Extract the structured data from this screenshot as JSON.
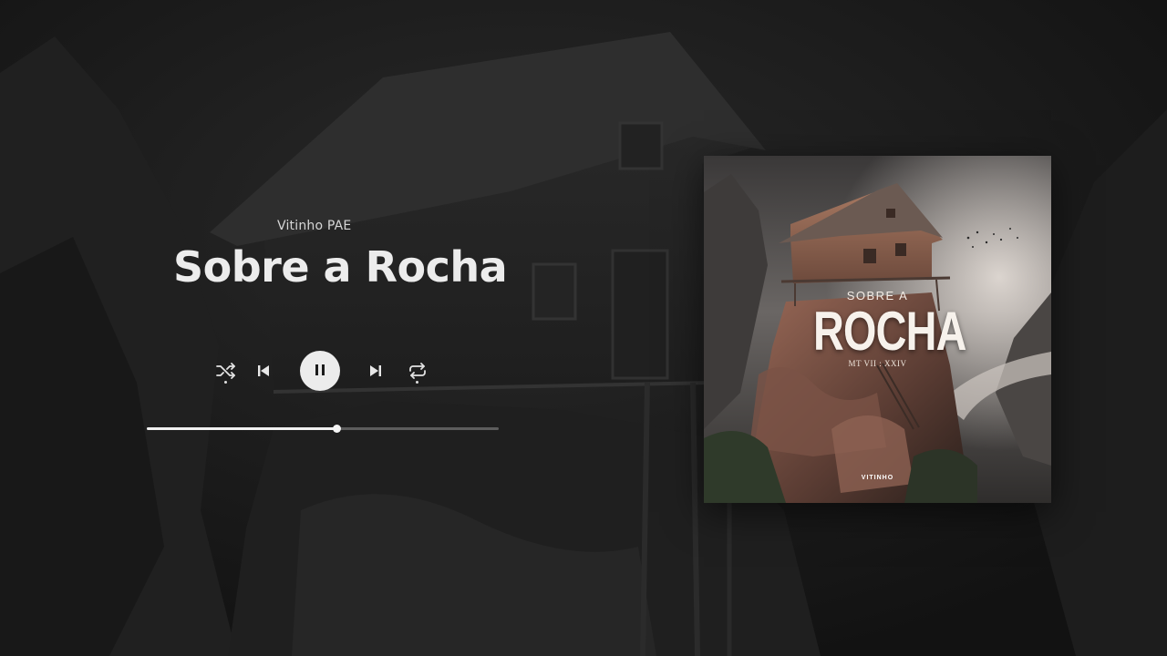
{
  "track": {
    "artist": "Vitinho PAE",
    "title": "Sobre a Rocha",
    "progress": 0.54
  },
  "controls": {
    "shuffle_icon": "shuffle-icon",
    "previous_icon": "skip-previous-icon",
    "play_state_icon": "pause-icon",
    "next_icon": "skip-next-icon",
    "repeat_icon": "repeat-icon"
  },
  "cover": {
    "subtitle": "SOBRE A",
    "title": "ROCHA",
    "reference": "MT VII : XXIV",
    "brand": "VITINHO"
  },
  "colors": {
    "background": "#1b1b1b",
    "text": "#ececec",
    "progress_track": "rgba(255,255,255,0.28)",
    "progress_fill": "#f0f0f0"
  }
}
